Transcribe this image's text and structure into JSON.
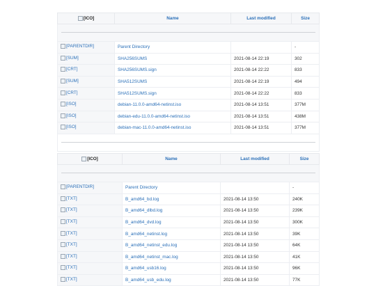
{
  "tables": [
    {
      "headers": {
        "icon": "[ICO]",
        "name": "Name",
        "modified": "Last modified",
        "size": "Size"
      },
      "rows": [
        {
          "icon": "[PARENTDIR]",
          "name": "Parent Directory",
          "modified": "",
          "size": "-"
        },
        {
          "icon": "[SUM]",
          "name": "SHA256SUMS",
          "modified": "2021-08-14 22:19",
          "size": "302"
        },
        {
          "icon": "[CRT]",
          "name": "SHA256SUMS.sign",
          "modified": "2021-08-14 22:22",
          "size": "833"
        },
        {
          "icon": "[SUM]",
          "name": "SHA512SUMS",
          "modified": "2021-08-14 22:19",
          "size": "494"
        },
        {
          "icon": "[CRT]",
          "name": "SHA512SUMS.sign",
          "modified": "2021-08-14 22:22",
          "size": "833"
        },
        {
          "icon": "[ISO]",
          "name": "debian-11.0.0-amd64-netinst.iso",
          "modified": "2021-08-14 13:51",
          "size": "377M"
        },
        {
          "icon": "[ISO]",
          "name": "debian-edu-11.0.0-amd64-netinst.iso",
          "modified": "2021-08-14 13:51",
          "size": "438M"
        },
        {
          "icon": "[ISO]",
          "name": "debian-mac-11.0.0-amd64-netinst.iso",
          "modified": "2021-08-14 13:51",
          "size": "377M"
        }
      ]
    },
    {
      "headers": {
        "icon": "[ICO]",
        "name": "Name",
        "modified": "Last modified",
        "size": "Size"
      },
      "rows": [
        {
          "icon": "[PARENTDIR]",
          "name": "Parent Directory",
          "modified": "",
          "size": "-"
        },
        {
          "icon": "[TXT]",
          "name": "B_amd64_bd.log",
          "modified": "2021-08-14 13:50",
          "size": "240K"
        },
        {
          "icon": "[TXT]",
          "name": "B_amd64_dlbd.log",
          "modified": "2021-08-14 13:50",
          "size": "239K"
        },
        {
          "icon": "[TXT]",
          "name": "B_amd64_dvd.log",
          "modified": "2021-08-14 13:50",
          "size": "300K"
        },
        {
          "icon": "[TXT]",
          "name": "B_amd64_netinst.log",
          "modified": "2021-08-14 13:50",
          "size": "39K"
        },
        {
          "icon": "[TXT]",
          "name": "B_amd64_netinst_edu.log",
          "modified": "2021-08-14 13:50",
          "size": "64K"
        },
        {
          "icon": "[TXT]",
          "name": "B_amd64_netinst_mac.log",
          "modified": "2021-08-14 13:50",
          "size": "41K"
        },
        {
          "icon": "[TXT]",
          "name": "B_amd64_usb16.log",
          "modified": "2021-08-14 13:50",
          "size": "96K"
        },
        {
          "icon": "[TXT]",
          "name": "B_amd64_usb_edu.log",
          "modified": "2021-08-14 13:50",
          "size": "77K"
        }
      ]
    }
  ]
}
